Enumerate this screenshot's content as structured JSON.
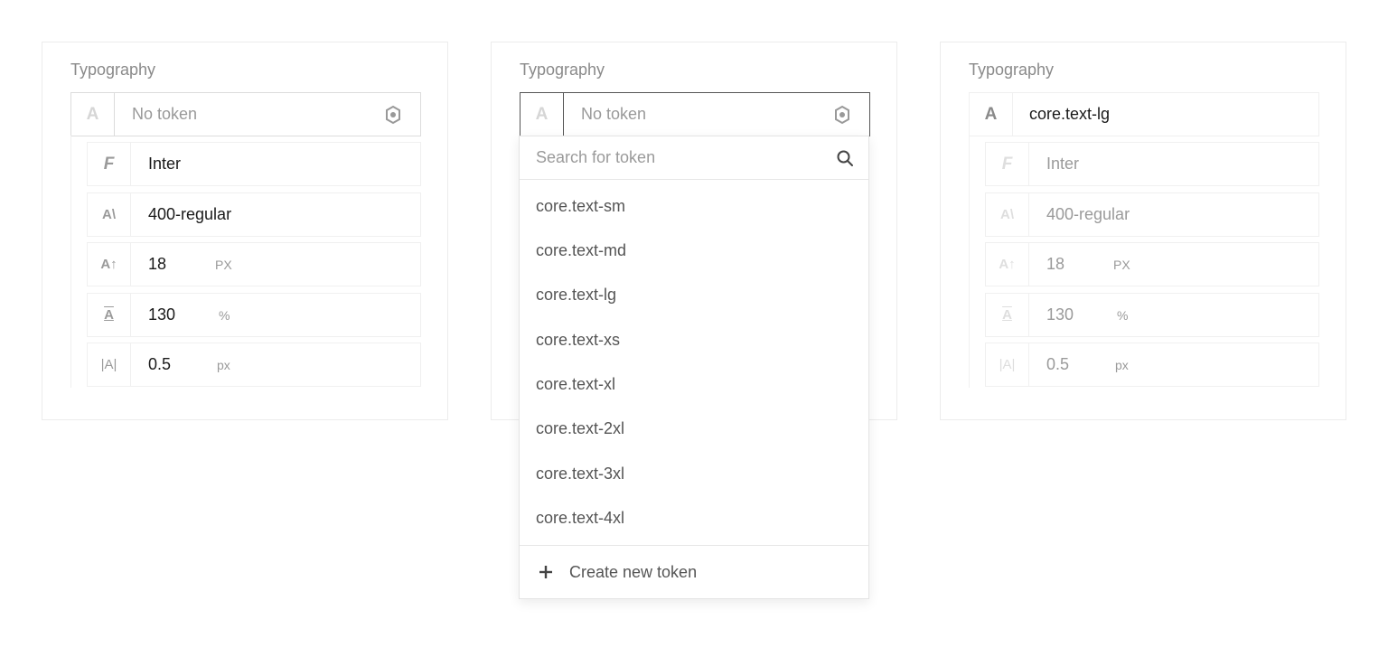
{
  "panels": [
    {
      "title": "Typography",
      "token": {
        "icon": "A",
        "value": "No token"
      },
      "rows": [
        {
          "icon": "F",
          "icon_name": "font-family-icon",
          "value": "Inter",
          "unit": ""
        },
        {
          "icon": "A\\",
          "icon_name": "font-weight-icon",
          "value": "400-regular",
          "unit": ""
        },
        {
          "icon": "A↑",
          "icon_name": "font-size-icon",
          "value": "18",
          "unit": "PX"
        },
        {
          "icon": "A",
          "icon_name": "line-height-icon",
          "value": "130",
          "unit": "%"
        },
        {
          "icon": "|A|",
          "icon_name": "letter-spacing-icon",
          "value": "0.5",
          "unit": "px"
        }
      ]
    },
    {
      "title": "Typography",
      "token": {
        "icon": "A",
        "value": "No token"
      }
    },
    {
      "title": "Typography",
      "token": {
        "icon": "A",
        "value": "core.text-lg"
      },
      "rows": [
        {
          "icon": "F",
          "value": "Inter",
          "unit": ""
        },
        {
          "icon": "A\\",
          "value": "400-regular",
          "unit": ""
        },
        {
          "icon": "A↑",
          "value": "18",
          "unit": "PX"
        },
        {
          "icon": "A",
          "value": "130",
          "unit": "%"
        },
        {
          "icon": "|A|",
          "value": "0.5",
          "unit": "px"
        }
      ]
    }
  ],
  "dropdown": {
    "search_placeholder": "Search for token",
    "items": [
      "core.text-sm",
      "core.text-md",
      "core.text-lg",
      "core.text-xs",
      "core.text-xl",
      "core.text-2xl",
      "core.text-3xl",
      "core.text-4xl"
    ],
    "create_label": "Create new token"
  },
  "colors": {
    "border": "#dcdcdc",
    "active_border": "#555555",
    "text": "#1a1a1a",
    "muted": "#9a9a9a"
  }
}
